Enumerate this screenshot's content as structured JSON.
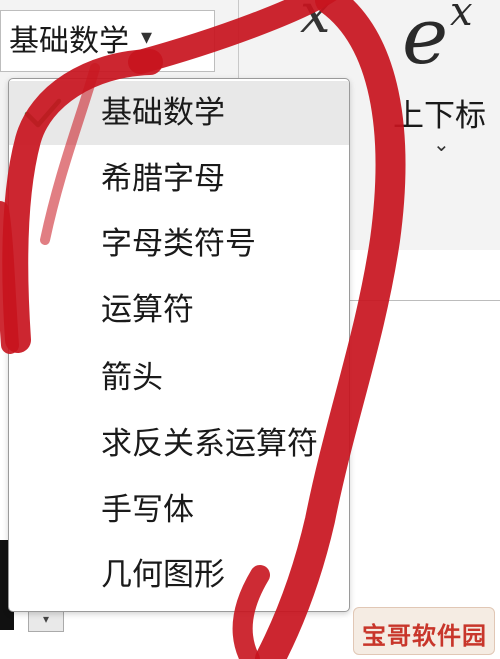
{
  "ribbon": {
    "category_combo": {
      "value": "基础数学"
    },
    "script_symbol": "x",
    "superscript_button": {
      "base": "e",
      "superscript": "x",
      "label": "上下标"
    }
  },
  "dropdown": {
    "selected_index": 0,
    "items": [
      {
        "label": "基础数学"
      },
      {
        "label": "希腊字母"
      },
      {
        "label": "字母类符号"
      },
      {
        "label": "运算符"
      },
      {
        "label": "箭头"
      },
      {
        "label": "求反关系运算符"
      },
      {
        "label": "手写体"
      },
      {
        "label": "几何图形"
      }
    ]
  },
  "watermark": {
    "text": "宝哥软件园"
  },
  "colors": {
    "annotation_red": "#c8141e",
    "check_green": "#3a9a4a",
    "watermark_red": "#c8362b"
  },
  "icons": {
    "check": "check-icon",
    "chevron": "chevron-down-icon"
  }
}
